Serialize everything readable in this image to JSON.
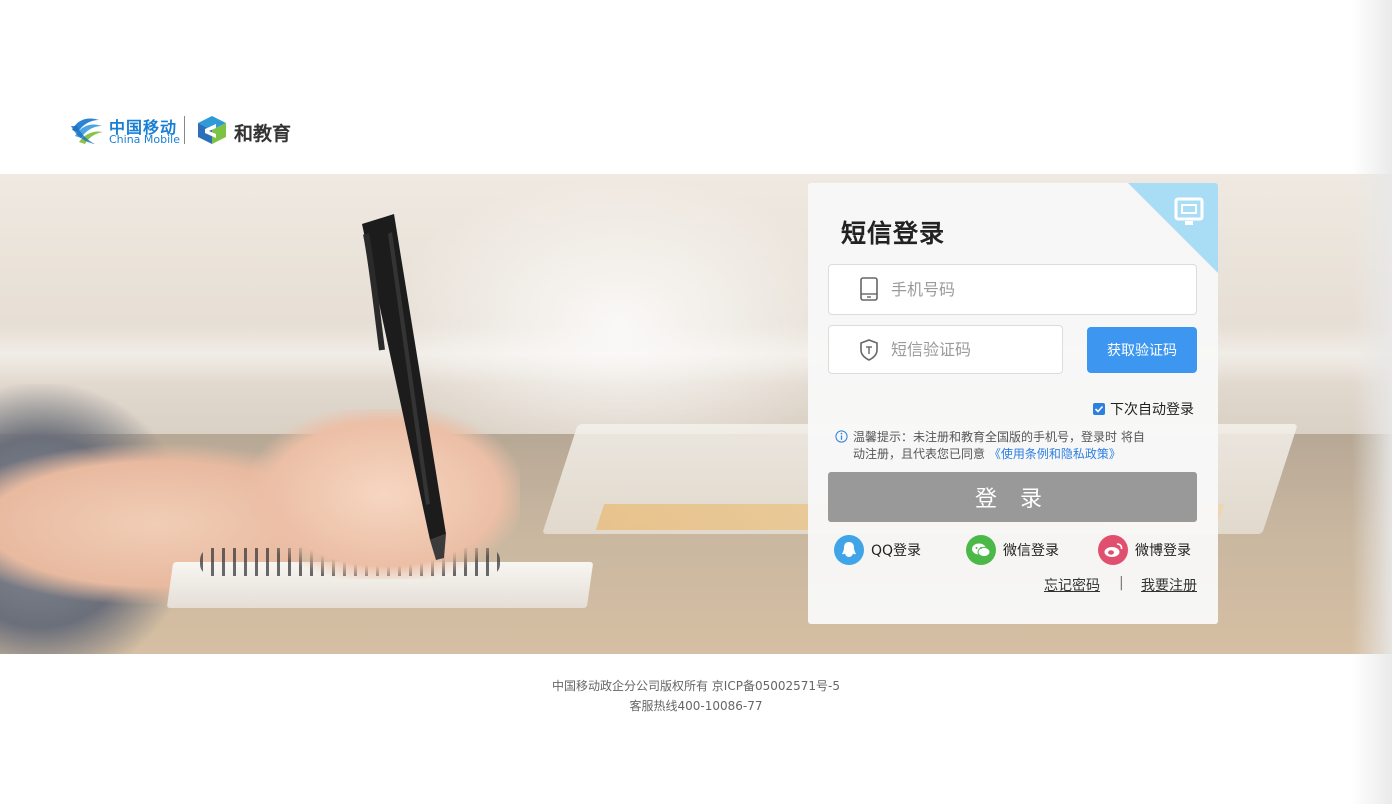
{
  "header": {
    "china_mobile_cn": "中国移动",
    "china_mobile_en": "China Mobile",
    "product_name": "和教育"
  },
  "login": {
    "title": "短信登录",
    "phone_placeholder": "手机号码",
    "code_placeholder": "短信验证码",
    "get_code_label": "获取验证码",
    "auto_login_label": "下次自动登录",
    "auto_login_checked": true,
    "tip_prefix": "温馨提示：未注册和教育全国版的手机号，登录时 将自动注册，且代表您已同意 ",
    "tip_link": "《使用条例和隐私政策》",
    "submit_label": "登 录",
    "social": {
      "qq": "QQ登录",
      "wechat": "微信登录",
      "weibo": "微博登录"
    },
    "forgot_label": "忘记密码",
    "separator": "|",
    "register_label": "我要注册"
  },
  "footer": {
    "line1": "中国移动政企分公司版权所有 京ICP备05002571号-5",
    "line2": "客服热线400-10086-77"
  },
  "colors": {
    "brand_blue": "#1a7fd4",
    "button_blue": "#3d97f0",
    "disabled_gray": "#999999",
    "qq": "#3fa4e8",
    "wechat": "#4cb848",
    "weibo": "#e0506e"
  },
  "icons": [
    "china-mobile-logo",
    "he-education-logo",
    "phone-icon",
    "shield-icon",
    "info-icon",
    "qq-icon",
    "wechat-icon",
    "weibo-icon",
    "monitor-icon"
  ]
}
